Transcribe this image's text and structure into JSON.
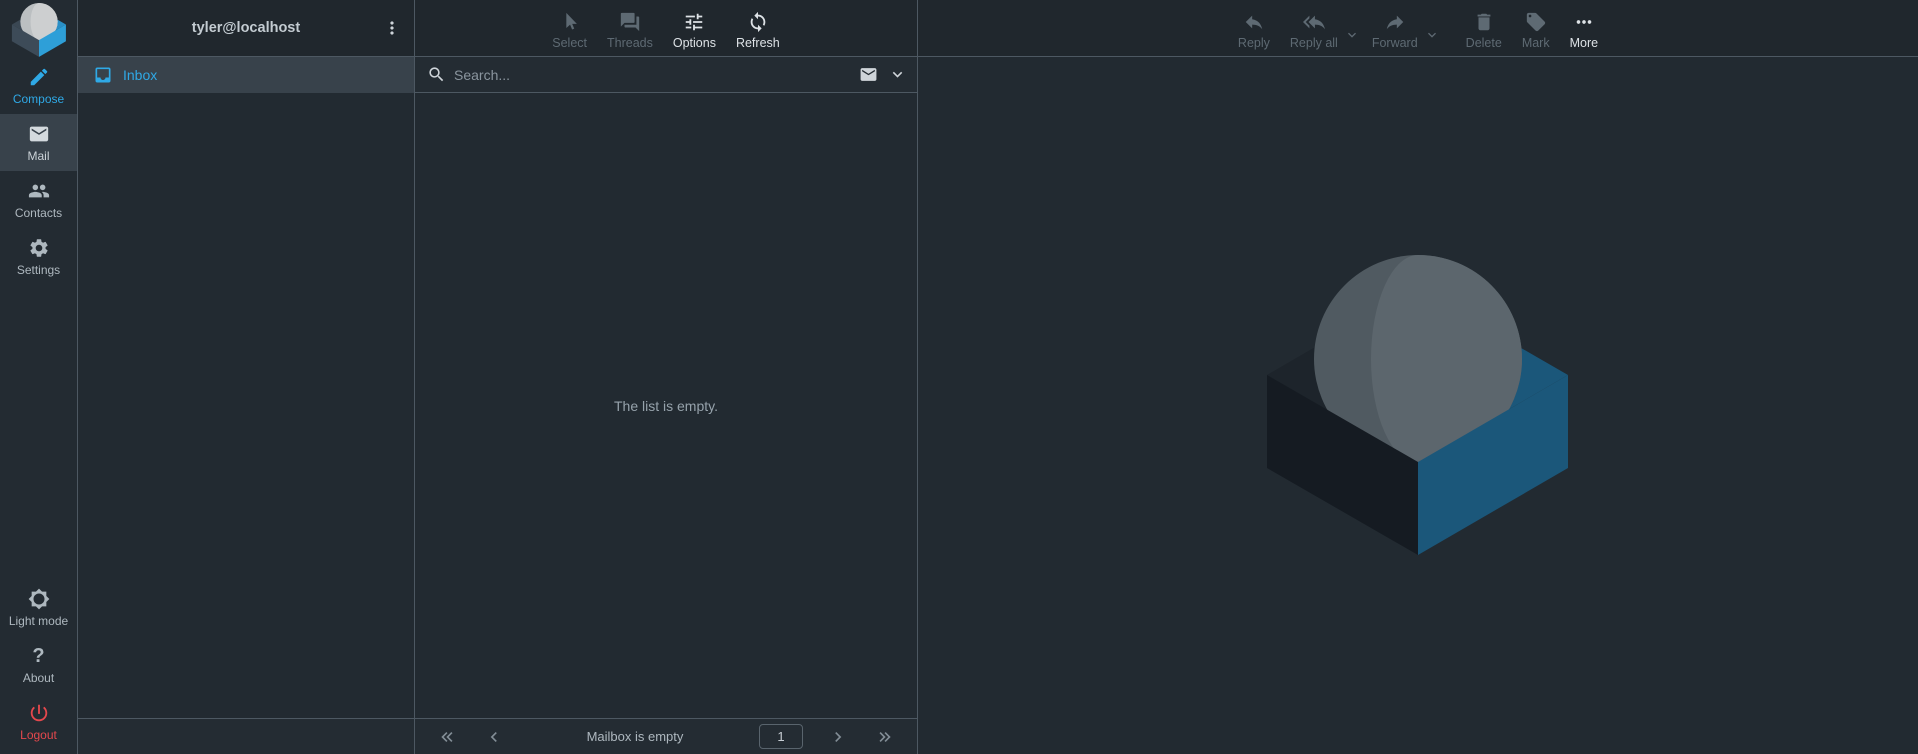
{
  "colors": {
    "accent_blue": "#2fa9e6",
    "logout_red": "#e5484d",
    "logo_blue": "#2e9fd8",
    "watermark_blue": "#1b577a"
  },
  "sidebar": {
    "items": [
      {
        "label": "Compose"
      },
      {
        "label": "Mail"
      },
      {
        "label": "Contacts"
      },
      {
        "label": "Settings"
      }
    ],
    "footer_items": [
      {
        "label": "Light mode"
      },
      {
        "label": "About"
      },
      {
        "label": "Logout"
      }
    ]
  },
  "folders": {
    "header_title": "tyler@localhost",
    "items": [
      {
        "label": "Inbox"
      }
    ]
  },
  "messages": {
    "toolbar": [
      {
        "label": "Select"
      },
      {
        "label": "Threads"
      },
      {
        "label": "Options"
      },
      {
        "label": "Refresh"
      }
    ],
    "search": {
      "placeholder": "Search..."
    },
    "empty_message": "The list is empty.",
    "footer": {
      "status": "Mailbox is empty",
      "page": "1"
    }
  },
  "content": {
    "toolbar": [
      {
        "label": "Reply"
      },
      {
        "label": "Reply all"
      },
      {
        "label": "Forward"
      },
      {
        "label": "Delete"
      },
      {
        "label": "Mark"
      },
      {
        "label": "More"
      }
    ]
  }
}
